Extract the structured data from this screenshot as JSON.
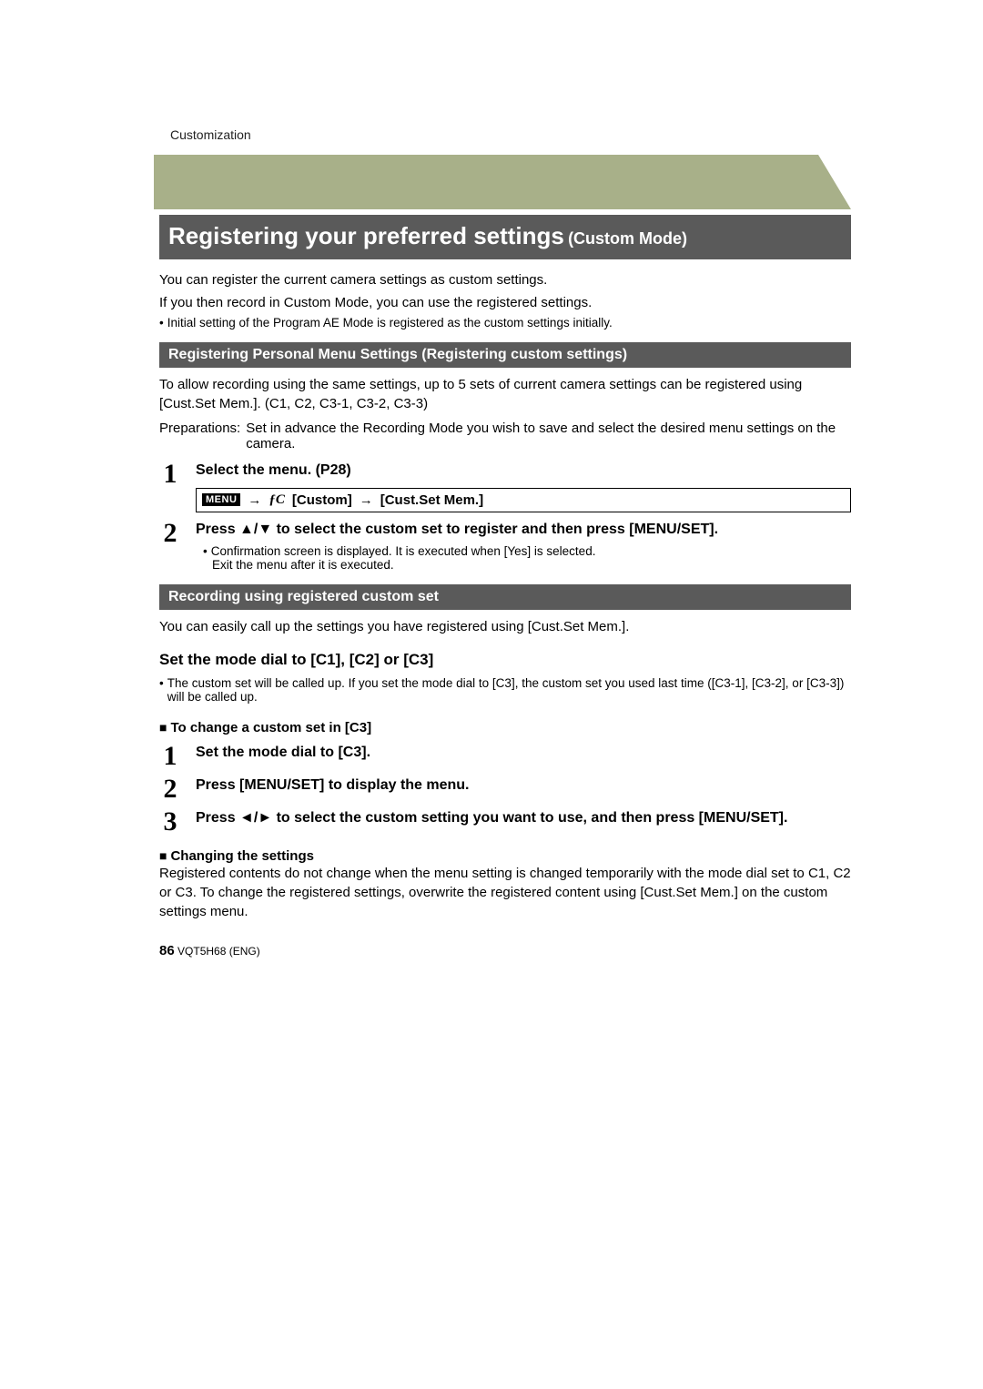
{
  "header": {
    "section": "Customization",
    "title_main": "Registering your preferred settings",
    "title_sub": "(Custom Mode)"
  },
  "intro": {
    "line1": "You can register the current camera settings as custom settings.",
    "line2": "If you then record in Custom Mode, you can use the registered settings.",
    "bullet": "Initial setting of the Program AE Mode is registered as the custom settings initially."
  },
  "register": {
    "heading": "Registering Personal Menu Settings (Registering custom settings)",
    "para_a": "To allow recording using the same settings, up to 5 sets of current camera settings can be registered using [Cust.Set Mem.]. (",
    "modes": "C1, C2, C3-1, C3-2, C3-3",
    "para_b": ")",
    "prep_label": "Preparations:",
    "prep_text": "Set in advance the Recording Mode you wish to save and select the desired menu settings on the camera.",
    "step1": "Select the menu. (P28)",
    "menu_path": {
      "badge": "MENU",
      "arrow1": "→",
      "fc": "ƒC",
      "custom": "[Custom]",
      "arrow2": "→",
      "dest": "[Cust.Set Mem.]"
    },
    "step2": "Press ▲/▼ to select the custom set to register and then press [MENU/SET].",
    "step2_note1": "Confirmation screen is displayed. It is executed when [Yes] is selected.",
    "step2_note2": "Exit the menu after it is executed."
  },
  "recording": {
    "heading": "Recording using registered custom set",
    "intro": "You can easily call up the settings you have registered using [Cust.Set Mem.].",
    "set_dial": "Set the mode dial to [C1], [C2] or [C3]",
    "note_a": "The custom set will be called up. If you set the mode dial to [",
    "note_c3": "C3",
    "note_b": "], the custom set you used last time ([",
    "note_list": "C3-1], [C3-2], or [C3-3",
    "note_c": "]) will be called up.",
    "change_heading": "To change a custom set in [C3]",
    "chg_step1": "Set the mode dial to [C3].",
    "chg_step2": "Press [MENU/SET] to display the menu.",
    "chg_step3": "Press ◄/► to select the custom setting you want to use, and then press [MENU/SET].",
    "changing_title": "Changing the settings",
    "changing_a": "Registered contents do not change when the menu setting is changed temporarily with the mode dial set to ",
    "changing_modes": "C1, C2 or C3",
    "changing_b": ". To change the registered settings, overwrite the registered content using [Cust.Set Mem.] on the custom settings menu."
  },
  "footer": {
    "page": "86",
    "doc_id": "VQT5H68 (ENG)"
  }
}
